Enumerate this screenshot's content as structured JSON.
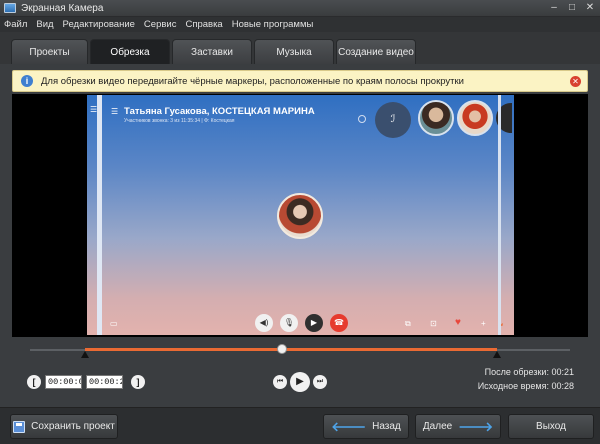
{
  "window": {
    "title": "Экранная Камера",
    "controls": [
      "‒",
      "□",
      "✕"
    ]
  },
  "menu": [
    "Файл",
    "Вид",
    "Редактирование",
    "Сервис",
    "Справка",
    "Новые программы"
  ],
  "tabs": [
    {
      "label": "Проекты",
      "active": false
    },
    {
      "label": "Обрезка",
      "active": true
    },
    {
      "label": "Заставки",
      "active": false
    },
    {
      "label": "Музыка",
      "active": false
    },
    {
      "label": "Создание видео",
      "active": false
    }
  ],
  "infobar": {
    "icon": "info-icon",
    "text": "Для обрезки видео передвигайте чёрные маркеры, расположенные по краям полосы прокрутки",
    "close_icon": "close-icon"
  },
  "video": {
    "call_title": "Татьяна Гусакова, КОСТЕЦКАЯ МАРИНА",
    "call_subtitle": "Участников звонка: 3 из 11:35:34  |  Ф: Костецкая"
  },
  "timeline": {
    "start_time": "00:00:03",
    "end_time": "00:00:24",
    "after_trim_label": "После обрезки:",
    "after_trim_value": "00:21",
    "source_time_label": "Исходное время:",
    "source_time_value": "00:28",
    "selection_fraction": [
      0.1,
      0.86
    ],
    "playhead_fraction": 0.46
  },
  "footer": {
    "save_label": "Сохранить проект",
    "back_label": "Назад",
    "next_label": "Далее",
    "exit_label": "Выход"
  },
  "colors": {
    "accent": "#ea6a33",
    "info_bg": "#fbf3c4",
    "arrow": "#4ea3e8"
  }
}
